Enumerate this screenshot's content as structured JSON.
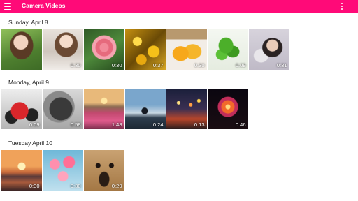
{
  "appbar": {
    "title": "Camera Videos",
    "menu_icon": "hamburger-menu-icon",
    "more_icon": "more-vert-icon",
    "color": "#ff0a78"
  },
  "sections": [
    {
      "header": "Sunday, April 8",
      "videos": [
        {
          "duration": ""
        },
        {
          "duration": "0:30"
        },
        {
          "duration": "0:30"
        },
        {
          "duration": "0:37"
        },
        {
          "duration": "0:30"
        },
        {
          "duration": "0:09"
        },
        {
          "duration": "0:31"
        }
      ]
    },
    {
      "header": "Monday, April 9",
      "videos": [
        {
          "duration": "0:09"
        },
        {
          "duration": "0:58"
        },
        {
          "duration": "1:48"
        },
        {
          "duration": "0:24"
        },
        {
          "duration": "0:13"
        },
        {
          "duration": "0:46"
        }
      ]
    },
    {
      "header": "Tuesday April 10",
      "videos": [
        {
          "duration": "0:30"
        },
        {
          "duration": "0:30"
        },
        {
          "duration": "0:29"
        }
      ]
    }
  ]
}
